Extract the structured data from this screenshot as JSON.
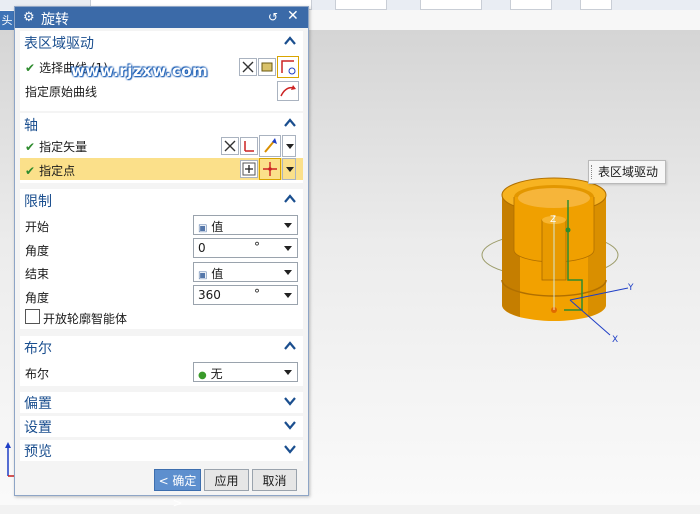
{
  "top_tab": {
    "label": "头"
  },
  "viewport": {
    "tooltip": "表区域驱动"
  },
  "dialog": {
    "title": "旋转",
    "sections": {
      "surface_drive": {
        "title": "表区域驱动",
        "select_curve": "选择曲线 (1)",
        "specify_original_curve": "指定原始曲线"
      },
      "axis": {
        "title": "轴",
        "specify_vector": "指定矢量",
        "specify_point": "指定点"
      },
      "limits": {
        "title": "限制",
        "start_label": "开始",
        "start_mode": "值",
        "start_angle_label": "角度",
        "start_angle_value": "0",
        "end_label": "结束",
        "end_mode": "值",
        "end_angle_label": "角度",
        "end_angle_value": "360",
        "angle_unit": "°",
        "open_profile_label": "开放轮廓智能体"
      },
      "boolean": {
        "title": "布尔",
        "label": "布尔",
        "value": "无"
      },
      "offset": {
        "title": "偏置"
      },
      "settings": {
        "title": "设置"
      },
      "preview": {
        "title": "预览"
      }
    },
    "buttons": {
      "ok": "< 确定 >",
      "apply": "应用",
      "cancel": "取消"
    }
  },
  "watermark": "www.rjzxw.com",
  "axis_labels": {
    "x": "X",
    "y": "Y",
    "z": "Z"
  },
  "colors": {
    "title_bar": "#3b6aa8",
    "section_header": "#1b4f8f",
    "highlight_row": "#fbe08a",
    "model_orange": "#f2a100",
    "ok_button": "#5d8fce"
  }
}
